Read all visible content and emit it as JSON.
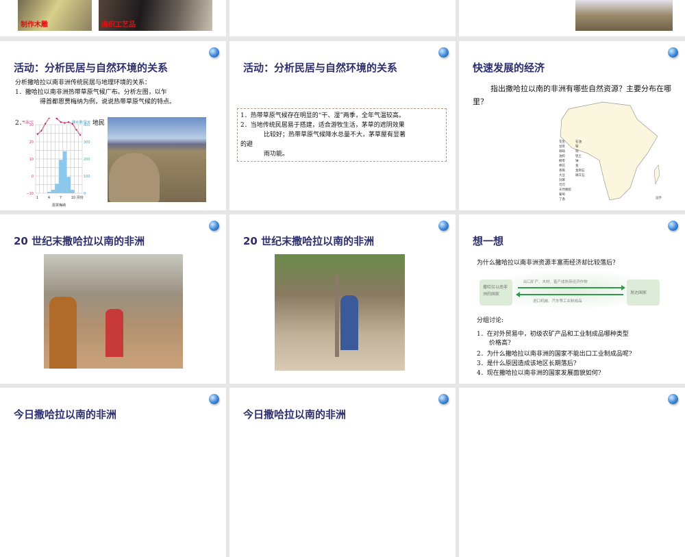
{
  "slides": [
    {
      "captions": [
        "制作木雕",
        "编织工艺品"
      ]
    },
    {},
    {},
    {
      "title": "活动：分析民居与自然环境的关系",
      "intro": "分析撒哈拉以南非洲传统民居与地理环境的关系：",
      "q1a": "1．撒哈拉以南非洲热带草原气候广布。分析左图，以乍",
      "q1b": "得首都恩贾梅纳为例，说说热带草原气候的特点。",
      "q2": "2．",
      "q2tail": "地民",
      "chart": {
        "left_label": "气温/℃",
        "right_label": "降水量/毫米",
        "left_ticks": [
          "30",
          "20",
          "10",
          "0",
          "−10"
        ],
        "right_ticks": [
          "400",
          "300",
          "200",
          "100",
          "0"
        ],
        "x_ticks": [
          "1",
          "4",
          "7",
          "10 月份"
        ],
        "city": "恩贾梅纳",
        "temperature": [
          24.5,
          26.5,
          30.5,
          34,
          35,
          33.5,
          31.5,
          31,
          31.5,
          30.5,
          27,
          24
        ],
        "precipitation": [
          0,
          0,
          0,
          8,
          20,
          55,
          195,
          245,
          95,
          20,
          0,
          0
        ]
      }
    },
    {
      "title": "活动：分析民居与自然环境的关系",
      "lines": [
        "1．热带草原气候存在明显的“干、湿”两季，全年气温较高。",
        "2．当地传统民居易于搭建，适合游牧生活，茅草的遮阴效果",
        "比较好；热带草原气候降水总量不大，茅草屋有显著",
        "的避",
        "雨功能。"
      ]
    },
    {
      "title": "快速发展的经济",
      "question": "指出撒哈拉以南的非洲有哪些自然资源？主要分布在哪里？",
      "legend_left": [
        "花生",
        "甘蔗",
        "咖啡",
        "油棕",
        "椰枣",
        "棉花",
        "香蕉",
        "大豆",
        "剑麻",
        "可可",
        "天然橡胶",
        "葡萄",
        "丁香"
      ],
      "legend_right": [
        "石油",
        "铁",
        "铜",
        "铝土",
        "铀",
        "金",
        "金刚石",
        "磷灰石"
      ],
      "boundary": "国界"
    },
    {
      "title": "20 世纪末撒哈拉以南的非洲"
    },
    {
      "title": "20 世纪末撒哈拉以南的非洲"
    },
    {
      "title": "想一想",
      "question": "为什么撒哈拉以南非洲资源丰富而经济却比较落后？",
      "left_box": "撒哈拉以南非洲的国家",
      "right_box": "发达国家",
      "export": "出口矿产、木材、畜产成热带经济作物",
      "import": "进口机械、汽车等工业制成品",
      "discuss": "分组讨论:",
      "items": [
        "1．在对外贸易中，初级农矿产品和工业制成品哪种类型",
        "价格高?",
        "2．为什么撒哈拉以南非洲的国家不能出口工业制成品呢?",
        "3．是什么原因造成该地区长期落后?",
        "4．现在撒哈拉以南非洲的国家发展面貌如何?"
      ]
    },
    {
      "title": "今日撒哈拉以南的非洲"
    },
    {
      "title": "今日撒哈拉以南的非洲"
    },
    {}
  ],
  "colors": {
    "title": "#2e2f6e",
    "caption": "#e01010",
    "temp_line": "#d0428a",
    "rain_bar": "#8cc8ec",
    "arrow": "#2e9a4a"
  }
}
